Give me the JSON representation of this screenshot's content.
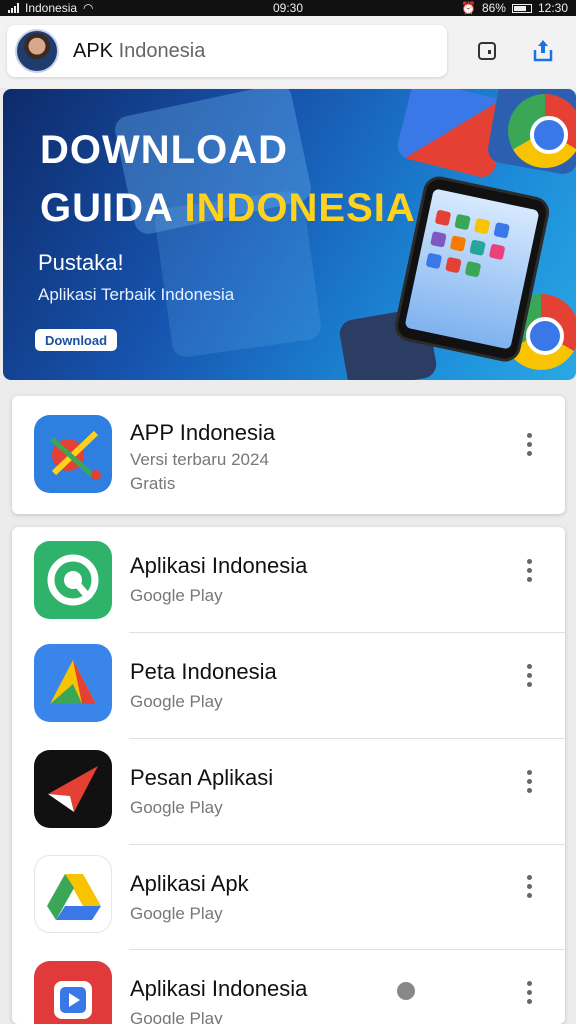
{
  "status_bar": {
    "carrier": "Indonesia",
    "time": "09:30",
    "battery": "86%",
    "right_time": "12:30"
  },
  "header": {
    "brand_strong": "APK",
    "brand_light": "Indonesia"
  },
  "banner": {
    "title_line1": "DOWNLOAD",
    "title_line2_white": "GUIDA",
    "title_line2_yellow": "INDONESIA",
    "subtitle": "Pustaka!",
    "description": "Aplikasi Terbaik Indonesia",
    "button_label": "Download"
  },
  "featured_app": {
    "title": "APP Indonesia",
    "subtitle": "Versi terbaru 2024",
    "tag": "Gratis"
  },
  "apps": [
    {
      "title": "Aplikasi Indonesia",
      "subtitle": "Google Play"
    },
    {
      "title": "Peta Indonesia",
      "subtitle": "Google Play"
    },
    {
      "title": "Pesan Aplikasi",
      "subtitle": "Google Play"
    },
    {
      "title": "Aplikasi Apk",
      "subtitle": "Google Play"
    },
    {
      "title": "Aplikasi Indonesia",
      "subtitle": "Google Play"
    }
  ]
}
